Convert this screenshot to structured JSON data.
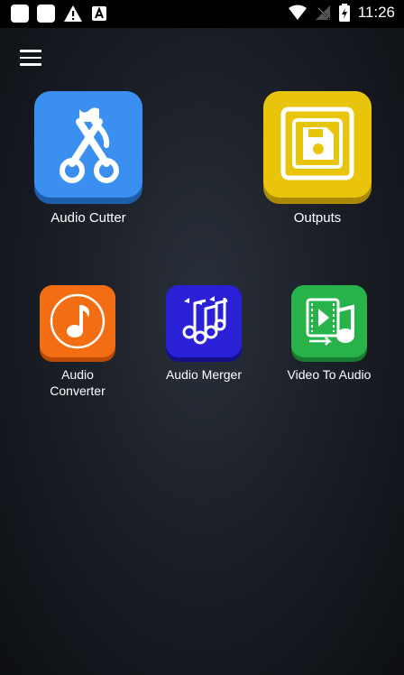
{
  "status_bar": {
    "time": "11:26"
  },
  "tiles": [
    {
      "label": "Audio Cutter",
      "color": "#3b8ff0"
    },
    {
      "label": "Outputs",
      "color": "#e8c40a"
    },
    {
      "label": "Audio\nConverter",
      "label_line1": "Audio",
      "label_line2": "Converter",
      "color": "#f36d12"
    },
    {
      "label": "Audio Merger",
      "color": "#2a21d6"
    },
    {
      "label": "Video To Audio",
      "color": "#27b34a"
    }
  ]
}
